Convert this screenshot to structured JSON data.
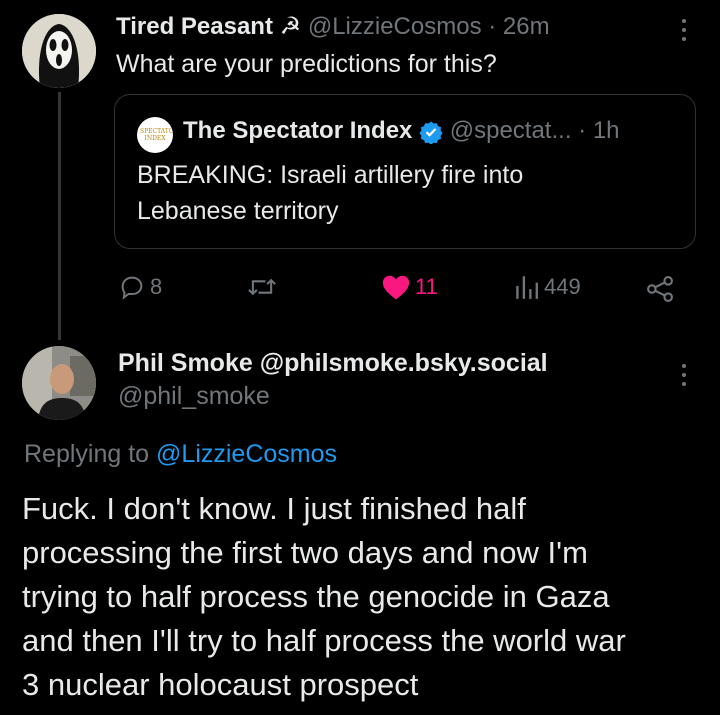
{
  "tweet1": {
    "author_name": "Tired Peasant ☭",
    "handle": "@LizzieCosmos",
    "separator": "·",
    "time": "26m",
    "text": "What are your predictions for this?",
    "quote": {
      "logo_text": "SPECTATOR INDEX",
      "author_name": "The Spectator Index",
      "handle": "@spectat...",
      "separator": "·",
      "time": "1h",
      "text_line1": "BREAKING: Israeli artillery fire into",
      "text_line2": "Lebanese territory"
    },
    "actions": {
      "replies": "8",
      "likes": "11",
      "views": "449"
    }
  },
  "tweet2": {
    "author_name": "Phil Smoke @philsmoke.bsky.social",
    "handle": "@phil_smoke",
    "replying_prefix": "Replying to",
    "replying_to": "@LizzieCosmos",
    "text_lines": [
      "Fuck. I don't know. I just finished half",
      "processing the first two days and now I'm",
      "trying to half process the genocide in Gaza",
      "and then I'll try to half process the world war",
      "3 nuclear holocaust prospect"
    ]
  },
  "colors": {
    "background": "#000000",
    "text": "#e7e9ea",
    "muted": "#71767b",
    "link": "#1d9bf0",
    "like": "#f91880",
    "verified": "#1d9bf0"
  },
  "icons": {
    "reply": "reply-icon",
    "retweet": "retweet-icon",
    "like": "heart-icon",
    "views": "views-icon",
    "share": "share-icon",
    "more": "more-icon",
    "verified": "verified-badge-icon"
  }
}
